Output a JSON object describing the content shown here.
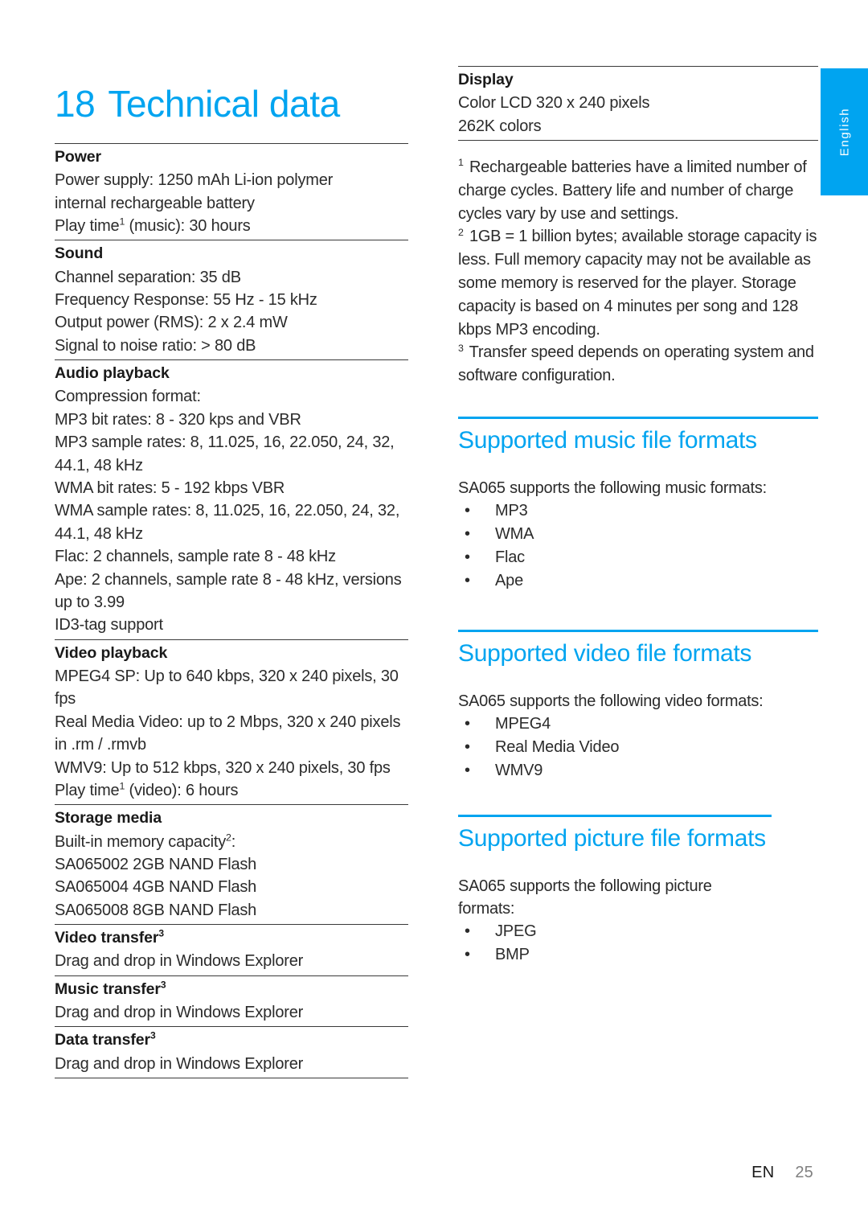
{
  "colors": {
    "brand_blue": "#00a4f0",
    "rule_dark": "#3a3a3a",
    "body_text": "#2b2b2b",
    "page_number": "#808080"
  },
  "language_tab": {
    "label": "English"
  },
  "chapter": {
    "number": "18",
    "title": "Technical data"
  },
  "spec_blocks": [
    {
      "heading": "Power",
      "lines": [
        "Power supply: 1250 mAh Li-ion polymer",
        "internal rechargeable battery",
        "Play time¹ (music): 30 hours"
      ]
    },
    {
      "heading": "Sound",
      "lines": [
        "Channel separation: 35 dB",
        "Frequency Response: 55 Hz - 15 kHz",
        "Output power (RMS): 2 x 2.4 mW",
        "Signal to noise ratio: > 80 dB"
      ]
    },
    {
      "heading": "Audio playback",
      "lines": [
        "Compression format:",
        "MP3 bit rates: 8 - 320 kps and VBR",
        "MP3 sample rates: 8, 11.025, 16, 22.050, 24, 32, 44.1, 48 kHz",
        "WMA bit rates: 5 - 192 kbps VBR",
        "WMA sample rates: 8, 11.025, 16, 22.050, 24, 32, 44.1, 48 kHz",
        "Flac: 2 channels, sample rate 8 - 48 kHz",
        "Ape: 2 channels, sample rate 8 - 48 kHz, versions up to 3.99",
        "ID3-tag support"
      ]
    },
    {
      "heading": "Video playback",
      "lines": [
        "MPEG4 SP: Up to 640 kbps, 320 x 240 pixels, 30 fps",
        "Real Media Video: up to 2 Mbps, 320 x 240 pixels in .rm / .rmvb",
        "WMV9: Up to 512 kbps, 320 x 240 pixels, 30 fps",
        "Play time¹ (video): 6 hours"
      ]
    },
    {
      "heading": "Storage media",
      "lines": [
        "Built-in memory capacity²:",
        "SA065002 2GB NAND Flash",
        "SA065004 4GB NAND Flash",
        "SA065008 8GB NAND Flash"
      ]
    },
    {
      "heading": "Video transfer³",
      "lines": [
        "Drag and drop in Windows Explorer"
      ]
    },
    {
      "heading": "Music transfer³",
      "lines": [
        "Drag and drop in Windows Explorer"
      ]
    },
    {
      "heading": "Data transfer³",
      "lines": [
        "Drag and drop in Windows Explorer"
      ]
    }
  ],
  "display_block": {
    "heading": "Display",
    "lines": [
      "Color LCD 320 x 240 pixels",
      "262K colors"
    ]
  },
  "footnotes": [
    {
      "mark": "1",
      "text": "Rechargeable batteries have a limited number of charge cycles. Battery life and number of charge cycles vary by use and settings."
    },
    {
      "mark": "2",
      "text": "1GB = 1 billion bytes; available storage capacity is less. Full memory capacity may not be available as some memory is reserved for the player. Storage capacity is based on 4 minutes per song and 128 kbps MP3 encoding."
    },
    {
      "mark": "3",
      "text": "Transfer speed depends on operating system and software configuration."
    }
  ],
  "sections": [
    {
      "title": "Supported music file formats",
      "intro": "SA065 supports the following music formats:",
      "items": [
        "MP3",
        "WMA",
        "Flac",
        "Ape"
      ]
    },
    {
      "title": "Supported video file formats",
      "intro": "SA065 supports the following video formats:",
      "items": [
        "MPEG4",
        "Real Media Video",
        "WMV9"
      ]
    },
    {
      "title": "Supported picture file formats",
      "intro": "SA065 supports the following picture formats:",
      "items": [
        "JPEG",
        "BMP"
      ]
    }
  ],
  "footer": {
    "language_code": "EN",
    "page_number": "25"
  }
}
